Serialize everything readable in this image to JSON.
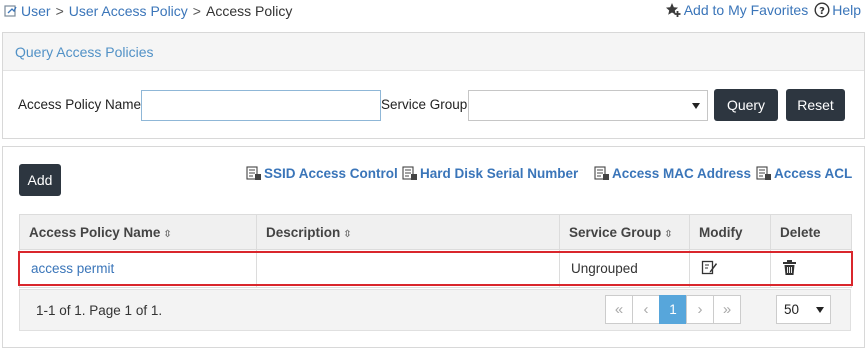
{
  "breadcrumb": {
    "items": [
      "User",
      "User Access Policy"
    ],
    "separator": ">",
    "current": "Access Policy"
  },
  "top_links": {
    "favorites": "Add to My Favorites",
    "help": "Help"
  },
  "query": {
    "title": "Query Access Policies",
    "name_label": "Access Policy Name",
    "name_value": "",
    "service_group_label": "Service Group",
    "service_group_value": "",
    "query_button": "Query",
    "reset_button": "Reset"
  },
  "toolbar": {
    "add_button": "Add",
    "links": [
      "SSID Access Control",
      "Hard Disk Serial Number",
      "Access MAC Address",
      "Access ACL"
    ]
  },
  "table": {
    "sort_glyph": "⇳",
    "columns": [
      "Access Policy Name",
      "Description",
      "Service Group",
      "Modify",
      "Delete"
    ],
    "rows": [
      {
        "name": "access permit",
        "description": "",
        "service_group": "Ungrouped"
      }
    ]
  },
  "pagination": {
    "info": "1-1 of 1. Page 1 of 1.",
    "first": "«",
    "prev": "‹",
    "current_page": "1",
    "next": "›",
    "last": "»",
    "page_size": "50"
  },
  "colors": {
    "link": "#3a75b9",
    "dark_button": "#2d3640",
    "active_page": "#57a6db",
    "highlight": "#d9262c"
  }
}
